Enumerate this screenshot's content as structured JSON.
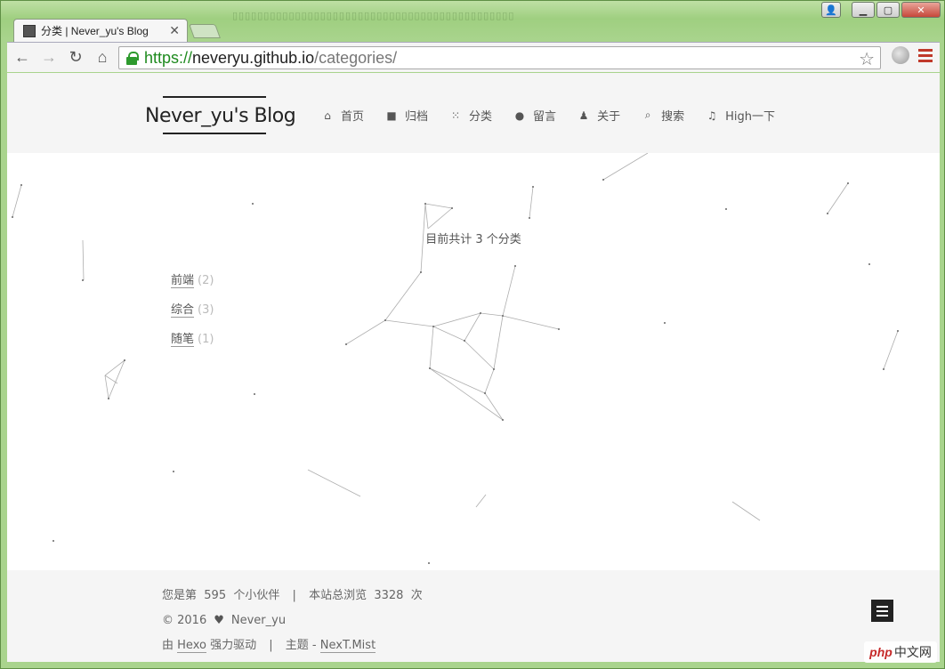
{
  "browser": {
    "tab_title": "分类 | Never_yu's Blog",
    "url_scheme": "https://",
    "url_host": "neveryu.github.io",
    "url_path": "/categories/",
    "icons": [
      "back-icon",
      "forward-icon",
      "reload-icon",
      "home-icon",
      "lock-icon",
      "star-icon",
      "globe-icon",
      "menu-icon"
    ]
  },
  "site": {
    "brand": "Never_yu's Blog",
    "menu": [
      {
        "label": "首页",
        "icon": "home-icon"
      },
      {
        "label": "归档",
        "icon": "archive-icon"
      },
      {
        "label": "分类",
        "icon": "grid-icon"
      },
      {
        "label": "留言",
        "icon": "comment-icon"
      },
      {
        "label": "关于",
        "icon": "user-icon"
      },
      {
        "label": "搜索",
        "icon": "search-icon"
      },
      {
        "label": "High一下",
        "icon": "music-icon"
      }
    ]
  },
  "main": {
    "count_text": "目前共计 3 个分类",
    "categories": [
      {
        "name": "前端",
        "count": "(2)"
      },
      {
        "name": "综合",
        "count": "(3)"
      },
      {
        "name": "随笔",
        "count": "(1)"
      }
    ]
  },
  "footer": {
    "visitor_prefix": "您是第",
    "visitor_count": "595",
    "visitor_suffix": "个小伙伴",
    "sep": "|",
    "pv_prefix": "本站总浏览",
    "pv_count": "3328",
    "pv_suffix": "次",
    "copyright": "© 2016",
    "author": "Never_yu",
    "powered_prefix": "由",
    "powered_link": "Hexo",
    "powered_suffix": "强力驱动",
    "theme_prefix": "主题 -",
    "theme_link": "NexT.Mist"
  },
  "watermark": {
    "php": "php",
    "cn": "中文网"
  }
}
